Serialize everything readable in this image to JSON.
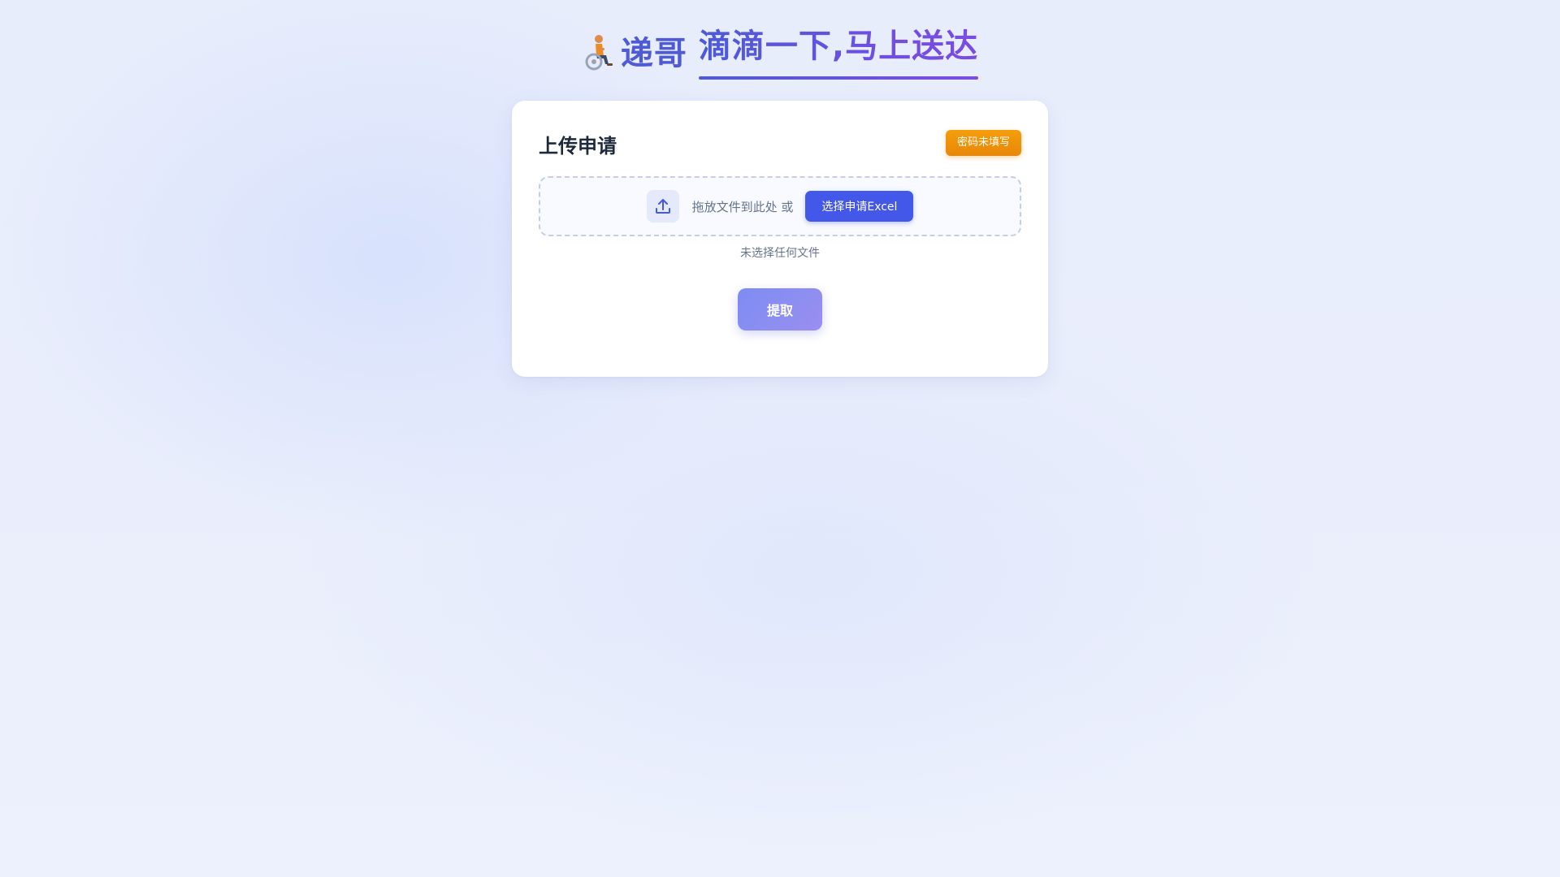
{
  "header": {
    "brand_icon": "person-in-wheelchair-icon",
    "brand_name": "递哥",
    "slogan": "滴滴一下,马上送达"
  },
  "card": {
    "title": "上传申请",
    "status_badge": "密码未填写",
    "dropzone": {
      "icon": "upload-icon",
      "hint": "拖放文件到此处 或",
      "choose_button_label": "选择申请Excel"
    },
    "file_status": "未选择任何文件",
    "extract_button_label": "提取"
  },
  "colors": {
    "brand": "#4f5bd5",
    "accent_button": "#4357e8",
    "warning_badge": "#f59e0b",
    "extract_button": "#8b8ef0"
  }
}
